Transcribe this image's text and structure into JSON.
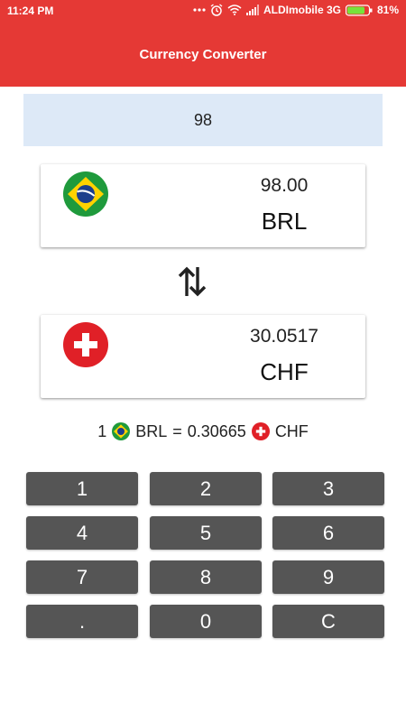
{
  "status_bar": {
    "time": "11:24 PM",
    "carrier": "ALDImobile 3G",
    "battery": "81%",
    "icons": [
      "more-dots-icon",
      "alarm-icon",
      "wifi-icon",
      "signal-icon",
      "battery-icon"
    ]
  },
  "app": {
    "title": "Currency Converter"
  },
  "colors": {
    "header": "#e53935",
    "input_bg": "#dde9f7",
    "key_bg": "#555555"
  },
  "amount_input": {
    "value": "98"
  },
  "from": {
    "value": "98.00",
    "code": "BRL",
    "flag_icon": "brazil-flag-icon"
  },
  "swap": {
    "icon": "swap-vertical-icon"
  },
  "to": {
    "value": "30.0517",
    "code": "CHF",
    "flag_icon": "switzerland-flag-icon"
  },
  "rate": {
    "amount": "1",
    "from_code": "BRL",
    "equals": "=",
    "value": "0.30665",
    "to_code": "CHF"
  },
  "keypad": {
    "keys": [
      "1",
      "2",
      "3",
      "4",
      "5",
      "6",
      "7",
      "8",
      "9",
      ".",
      "0",
      "C"
    ]
  }
}
